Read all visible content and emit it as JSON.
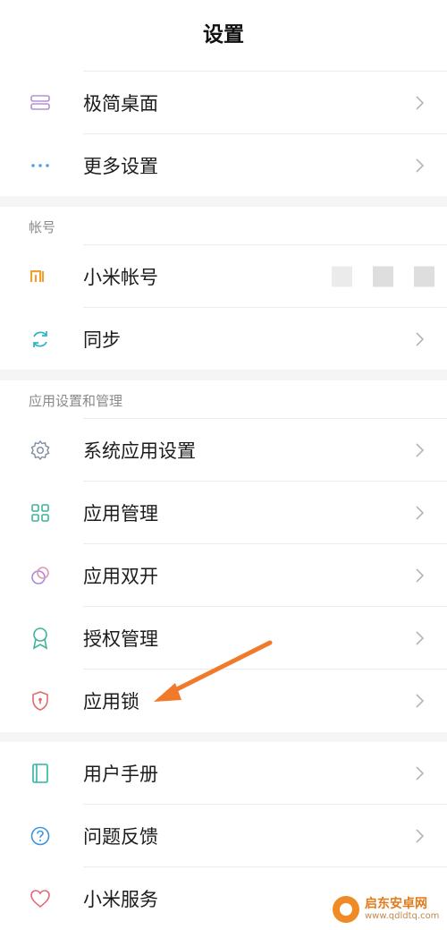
{
  "header": {
    "title": "设置"
  },
  "group1": [
    {
      "label": "极简桌面",
      "icon": "minimal-desktop-icon"
    },
    {
      "label": "更多设置",
      "icon": "more-dots-icon"
    }
  ],
  "account_section": {
    "title": "帐号",
    "items": [
      {
        "label": "小米帐号",
        "icon": "mi-logo-icon"
      },
      {
        "label": "同步",
        "icon": "sync-icon"
      }
    ]
  },
  "apps_section": {
    "title": "应用设置和管理",
    "items": [
      {
        "label": "系统应用设置",
        "icon": "gear-icon"
      },
      {
        "label": "应用管理",
        "icon": "apps-grid-icon"
      },
      {
        "label": "应用双开",
        "icon": "dual-app-icon"
      },
      {
        "label": "授权管理",
        "icon": "badge-icon"
      },
      {
        "label": "应用锁",
        "icon": "shield-lock-icon"
      }
    ]
  },
  "group4": [
    {
      "label": "用户手册",
      "icon": "book-icon"
    },
    {
      "label": "问题反馈",
      "icon": "question-icon"
    },
    {
      "label": "小米服务",
      "icon": "heart-icon"
    }
  ],
  "watermark": {
    "name": "启东安卓网",
    "url": "www.qdldtq.com"
  },
  "colors": {
    "accent_arrow": "#f07a2a",
    "section_gap": "#f5f5f5"
  }
}
